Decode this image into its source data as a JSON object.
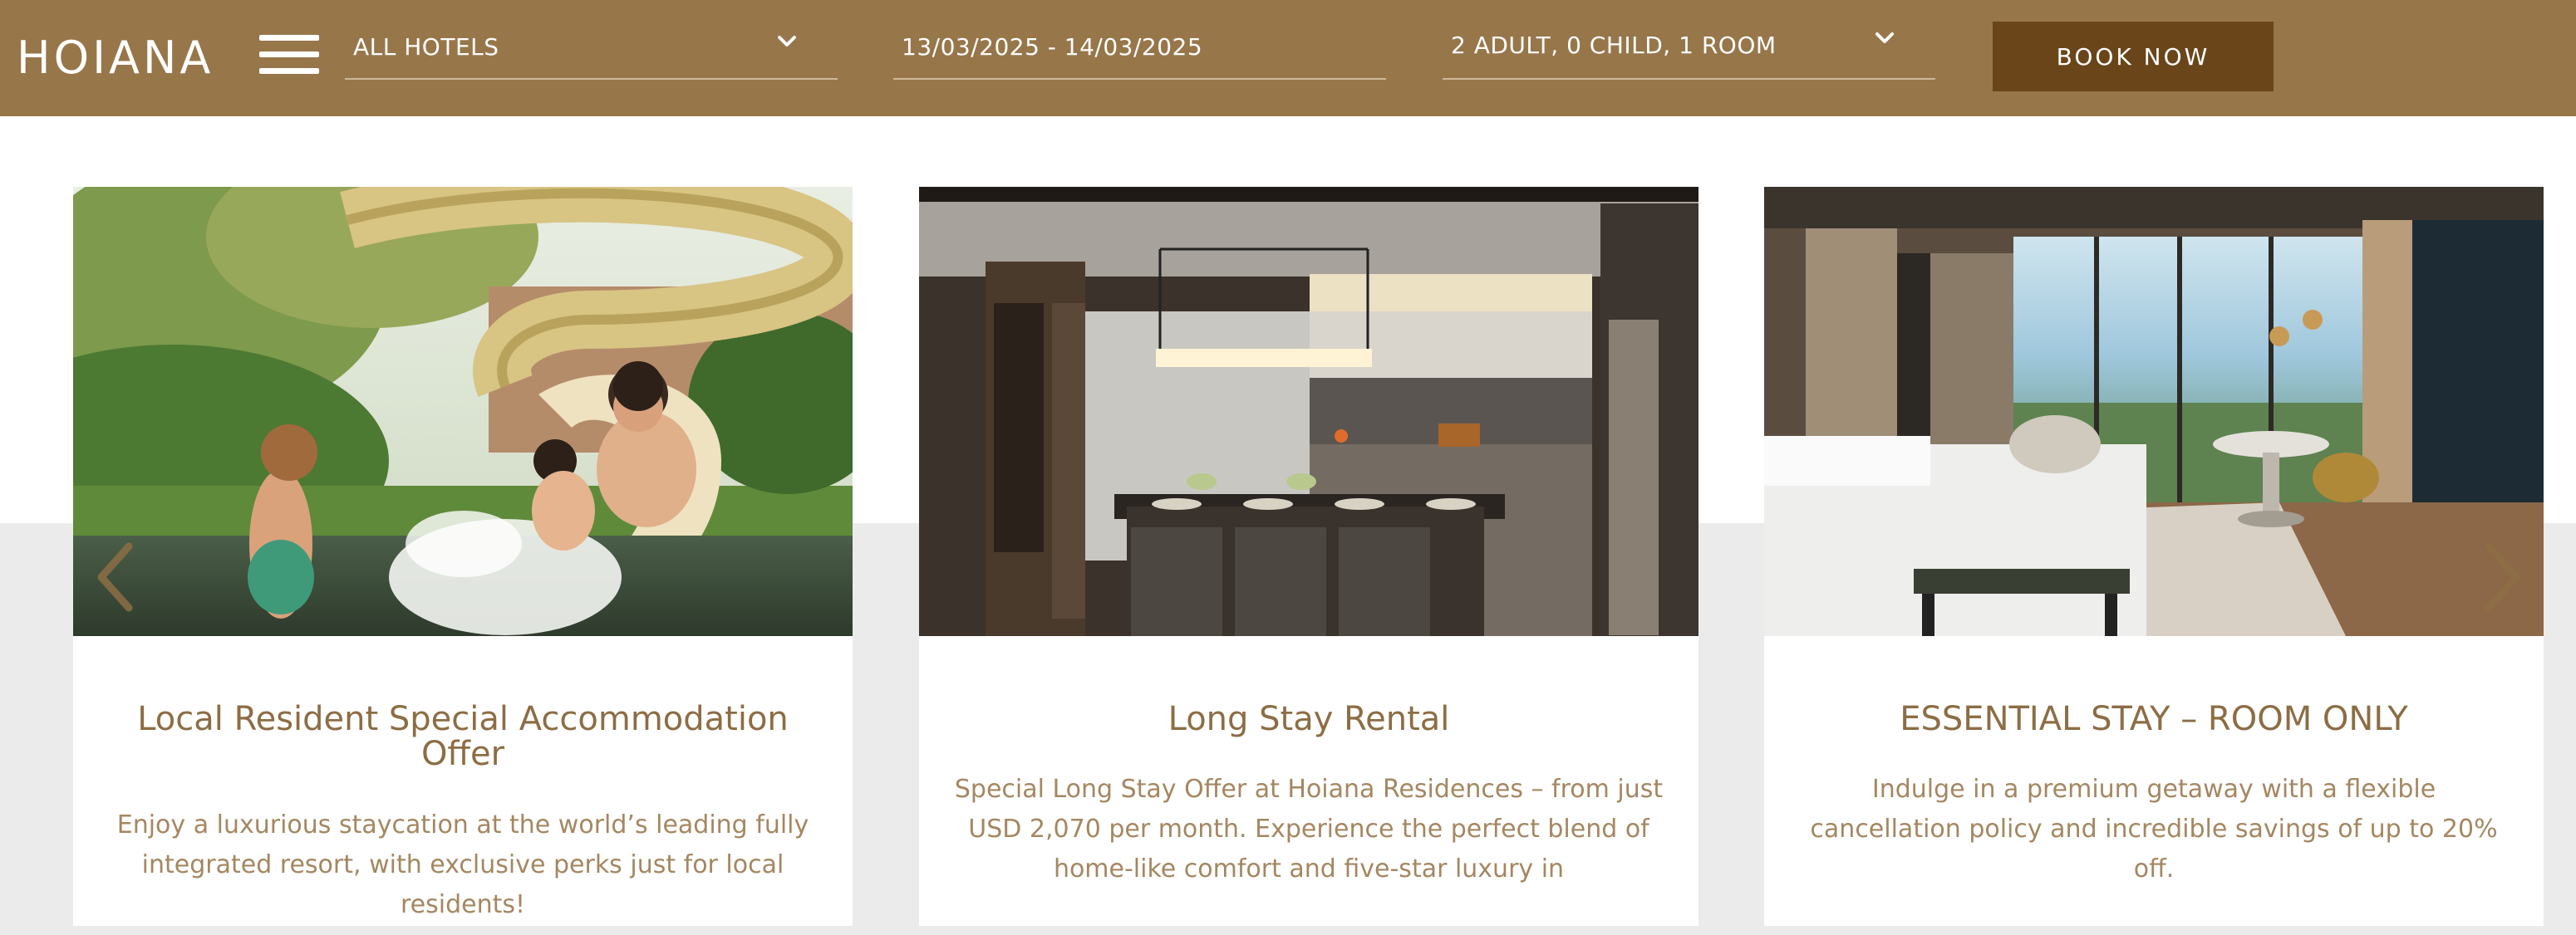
{
  "header": {
    "logo": "HOIANA",
    "hotel_select": "ALL HOTELS",
    "date_range": "13/03/2025 - 14/03/2025",
    "guests_select": "2 ADULT, 0 CHILD, 1 ROOM",
    "book_button": "BOOK NOW"
  },
  "offers": [
    {
      "title": "Local Resident Special Accommodation Offer",
      "description": "Enjoy a luxurious staycation at the world’s leading fully integrated resort, with exclusive perks just for local residents!",
      "image": "family-waterslide-pool-photo"
    },
    {
      "title": "Long Stay Rental",
      "description": "Special Long Stay Offer at Hoiana Residences – from just USD 2,070 per month. Experience the perfect blend of home-like comfort and five-star luxury in",
      "image": "residence-kitchen-dining-photo"
    },
    {
      "title": "ESSENTIAL STAY – ROOM ONLY",
      "description": "Indulge in a premium getaway with a flexible cancellation policy and incredible savings of up to 20% off.",
      "image": "ocean-view-bedroom-photo"
    }
  ],
  "carousel": {
    "prev_icon": "chevron-left-icon",
    "next_icon": "chevron-right-icon"
  },
  "colors": {
    "header_bg": "#97764a",
    "book_button_bg": "#6a4519",
    "title_text": "#8c6d44",
    "body_text": "#a48761",
    "band_bg": "#ebebeb"
  }
}
